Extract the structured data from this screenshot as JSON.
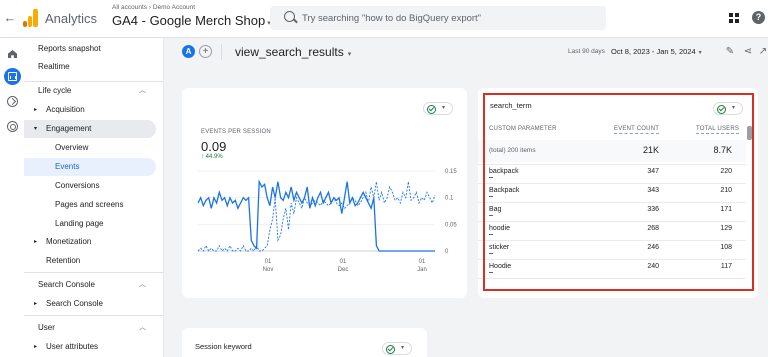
{
  "topbar": {
    "back_icon": "arrow-back-icon",
    "app_title": "Analytics",
    "breadcrumb": "All accounts › Demo Account",
    "account_name": "GA4 - Google Merch Shop",
    "account_caret": "▾",
    "search_placeholder": "Try searching \"how to do BigQuery export\"",
    "apps_icon": "apps-grid-icon",
    "help_icon": "help-icon",
    "help_glyph": "?"
  },
  "rail": {
    "items": [
      "home-icon",
      "reports-icon",
      "explore-icon",
      "advertising-icon"
    ],
    "accent": "#1a73e8"
  },
  "sidebar": {
    "reports_snapshot": "Reports snapshot",
    "realtime": "Realtime",
    "life_cycle": "Life cycle",
    "acquisition": "Acquisition",
    "engagement": "Engagement",
    "overview": "Overview",
    "events": "Events",
    "conversions": "Conversions",
    "pages_and_screens": "Pages and screens",
    "landing_page": "Landing page",
    "monetization": "Monetization",
    "retention": "Retention",
    "search_console_section": "Search Console",
    "search_console_item": "Search Console",
    "user_section": "User",
    "user_attributes": "User attributes",
    "expand_glyph": "▸",
    "open_glyph": "▾",
    "collapse_glyph": "︿"
  },
  "header": {
    "avatar_letter": "A",
    "add_glyph": "+",
    "page_title": "view_search_results",
    "title_caret": "▾",
    "date_label": "Last 90 days",
    "date_range": "Oct 8, 2023 - Jan 5, 2024",
    "date_caret": "▾",
    "edit_glyph": "✎",
    "share_glyph": "⋖",
    "insights_glyph": "↗"
  },
  "chart_card": {
    "metric_label": "EVENTS PER SESSION",
    "metric_value": "0.09",
    "metric_delta": "↑ 44.9%",
    "dropdown_glyph": "▾"
  },
  "chart_data": {
    "type": "line",
    "title": "",
    "xlabel": "",
    "ylabel": "",
    "ylim": [
      0,
      0.15
    ],
    "y_ticks": [
      "0.15",
      "0.1",
      "0.05",
      "0"
    ],
    "x_ticks": [
      {
        "day": "01",
        "month": "Nov"
      },
      {
        "day": "01",
        "month": "Dec"
      },
      {
        "day": "01",
        "month": "Jan"
      }
    ],
    "series": [
      {
        "name": "",
        "style": "solid",
        "color": "#1a73e8",
        "values": [
          0.09,
          0.1,
          0.085,
          0.095,
          0.1,
          0.08,
          0.1,
          0.09,
          0.11,
          0.095,
          0.1,
          0.085,
          0.1,
          0.09,
          0.095,
          0.08,
          0.09,
          0.1,
          0.095,
          0.1,
          0.02,
          0.01,
          0.005,
          0.13,
          0.12,
          0.125,
          0.1,
          0.085,
          0.12,
          0.1,
          0.13,
          0.1,
          0.095,
          0.11,
          0.1,
          0.12,
          0.095,
          0.11,
          0.1,
          0.09,
          0.1,
          0.12,
          0.08,
          0.1,
          0.085,
          0.1,
          0.11,
          0.09,
          0.1,
          0.11,
          0.09,
          0.1,
          0.095,
          0.1,
          0.07,
          0.1,
          0.13,
          0.09,
          0.1,
          0.085,
          0.09,
          0.1,
          0.11,
          0.1,
          0.09,
          0.08,
          0.1,
          0.01,
          0.0,
          0.0,
          0.0,
          0.0,
          0.0,
          0.0,
          0.0,
          0.0,
          0.0,
          0.0,
          0.0,
          0.0,
          0.0,
          0.0,
          0.0,
          0.0,
          0.0,
          0.0,
          0.0,
          0.0,
          0.0,
          0.0
        ]
      },
      {
        "name": "",
        "style": "dashed",
        "color": "#1a73e8",
        "values": [
          0.0,
          0.005,
          0.0,
          0.01,
          0.0,
          0.005,
          0.0,
          0.0,
          0.01,
          0.0,
          0.005,
          0.0,
          0.01,
          0.0,
          0.0,
          0.005,
          0.0,
          0.01,
          0.0,
          0.0,
          0.005,
          0.0,
          0.01,
          0.0,
          0.0,
          0.005,
          0.01,
          0.04,
          0.06,
          0.1,
          0.02,
          0.03,
          0.06,
          0.08,
          0.04,
          0.09,
          0.07,
          0.1,
          0.09,
          0.08,
          0.1,
          0.09,
          0.085,
          0.09,
          0.095,
          0.09,
          0.085,
          0.095,
          0.09,
          0.085,
          0.09,
          0.1,
          0.09,
          0.085,
          0.09,
          0.08,
          0.085,
          0.09,
          0.1,
          0.095,
          0.085,
          0.09,
          0.1,
          0.11,
          0.09,
          0.12,
          0.1,
          0.13,
          0.095,
          0.11,
          0.09,
          0.1,
          0.12,
          0.11,
          0.095,
          0.1,
          0.09,
          0.11,
          0.1,
          0.13,
          0.095,
          0.1,
          0.11,
          0.09,
          0.1,
          0.095,
          0.11,
          0.1,
          0.09,
          0.105
        ]
      }
    ]
  },
  "term_card": {
    "title": "search_term",
    "dropdown_glyph": "▾",
    "columns": [
      "CUSTOM PARAMETER",
      "EVENT COUNT",
      "TOTAL USERS"
    ],
    "total": {
      "label": "(total) 200 items",
      "event_count": "21K",
      "total_users": "8.7K"
    },
    "rows": [
      {
        "term": "backpack",
        "event_count": "347",
        "total_users": "220"
      },
      {
        "term": "Backpack",
        "event_count": "343",
        "total_users": "210"
      },
      {
        "term": "Bag",
        "event_count": "336",
        "total_users": "171"
      },
      {
        "term": "hoodie",
        "event_count": "268",
        "total_users": "129"
      },
      {
        "term": "sticker",
        "event_count": "246",
        "total_users": "108"
      },
      {
        "term": "Hoodie",
        "event_count": "240",
        "total_users": "117"
      },
      {
        "term": "lanyard",
        "event_count": "209",
        "total_users": "122"
      }
    ],
    "outline_color": "#d93025"
  },
  "kw_card": {
    "title": "Session keyword",
    "dropdown_glyph": "▾"
  }
}
